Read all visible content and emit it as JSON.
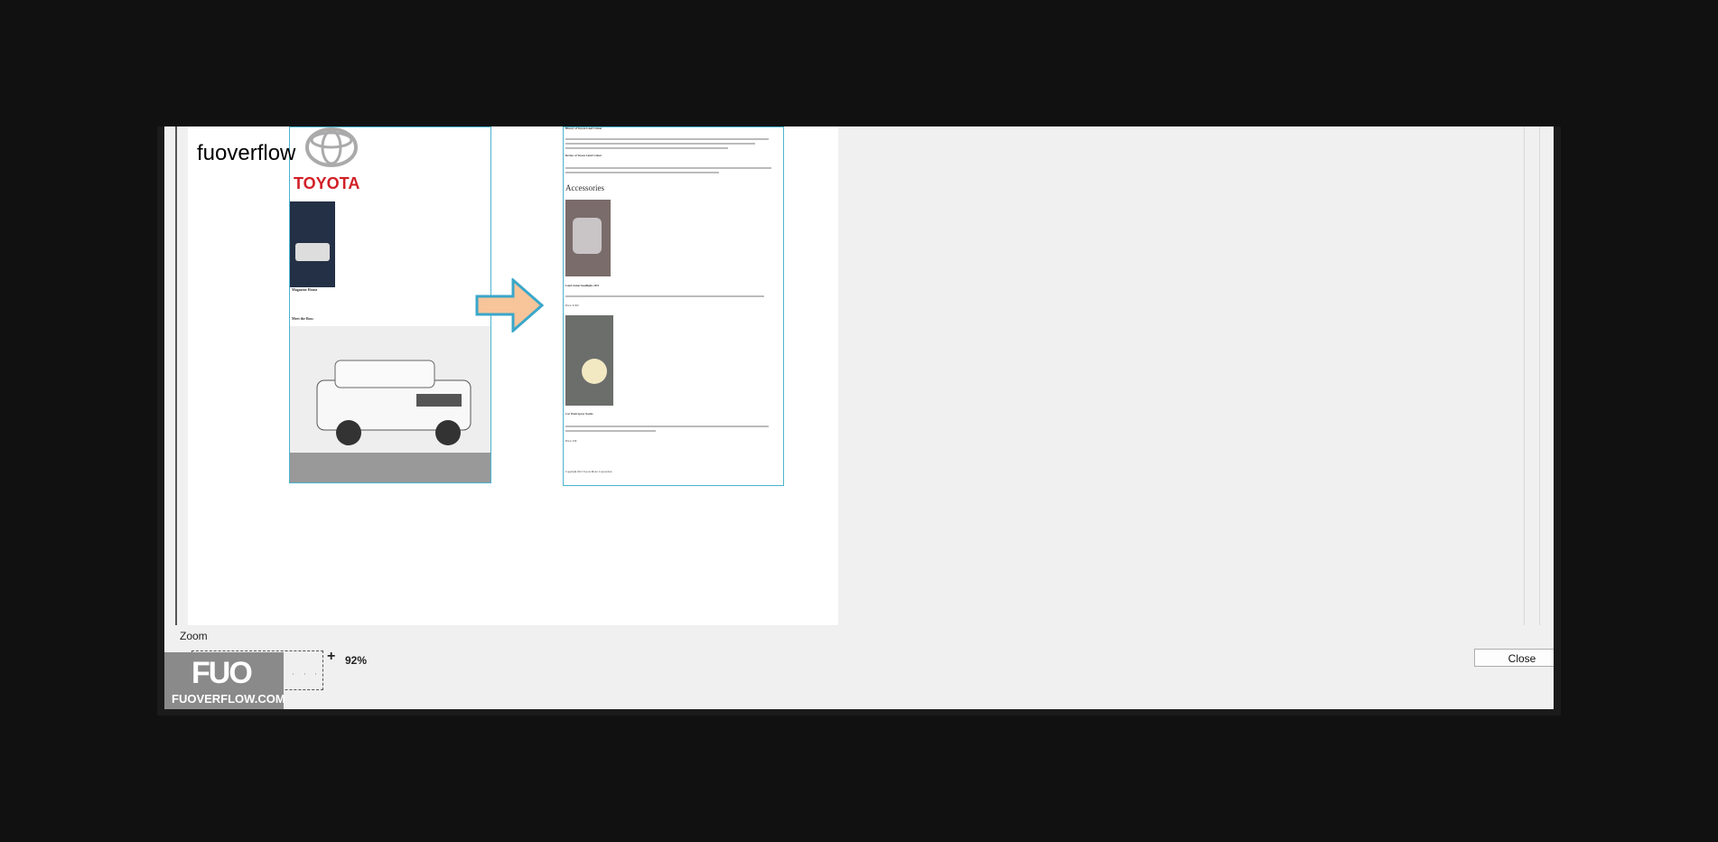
{
  "watermark": {
    "text": "fuoverflow",
    "logo_text": "FUO",
    "logo_site": "FUOVERFLOW.COM"
  },
  "preview": {
    "left_page": {
      "brand": "TOYOTA",
      "title": "Magazine House",
      "subtitle": "Meet the Boss"
    },
    "right_page": {
      "heading1": "History of Toyota Land Cruiser",
      "heading2": "Review of Toyota Land Cruiser",
      "section": "Accessories",
      "item1": "Land cruiser headlights 2021",
      "item2": "Car Wash Spray Nozzle",
      "price1": "Price: $ 500",
      "price2": "Price: 25$",
      "footer": "Copyright 2021 Toyota Motor Corporation"
    }
  },
  "zoom": {
    "label": "Zoom",
    "minus": "-",
    "plus": "+",
    "value": "92%",
    "slider_level_percent": 92
  },
  "buttons": {
    "close": "Close"
  },
  "colors": {
    "accent_border": "#4bb3cf",
    "arrow_fill": "#f8c49a",
    "toyota_red": "#d21f26",
    "slider_thumb": "#1b62a8"
  }
}
